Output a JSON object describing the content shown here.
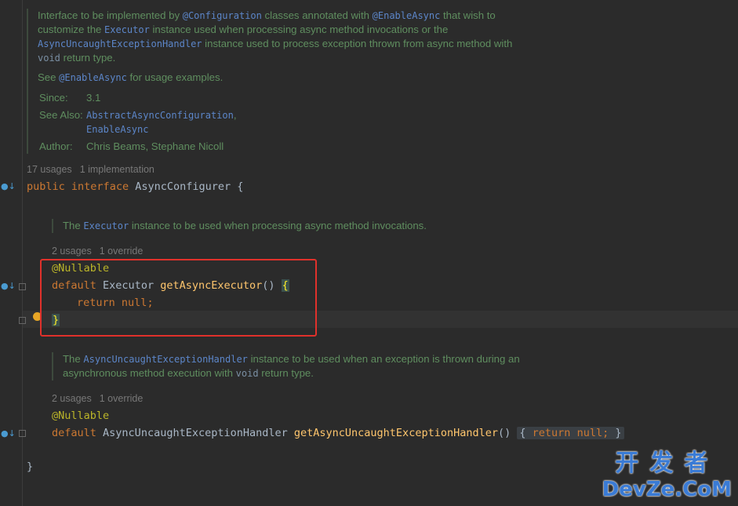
{
  "top_doc": {
    "line1_pre": "Interface to be implemented by ",
    "line1_link1": "@Configuration",
    "line1_mid": " classes annotated with ",
    "line1_link2": "@EnableAsync",
    "line1_post": " that wish to",
    "line2_pre": "customize the ",
    "line2_code": "Executor",
    "line2_post": " instance used when processing async method invocations or the",
    "line3_code": "AsyncUncaughtExceptionHandler",
    "line3_post": " instance used to process exception thrown from async method with",
    "line4_code": "void",
    "line4_post": " return type.",
    "see_pre": "See ",
    "see_link": "@EnableAsync",
    "see_post": " for usage examples.",
    "since_label": "Since:",
    "since_value": "3.1",
    "see_also_label": "See Also:",
    "see_also_1": "AbstractAsyncConfiguration",
    "see_also_comma": ",",
    "see_also_2": "EnableAsync",
    "author_label": "Author:",
    "author_value": "Chris Beams, Stephane Nicoll"
  },
  "interface_meta": {
    "usages": "17 usages",
    "impls": "1 implementation"
  },
  "interface_line": {
    "kw1": "public",
    "kw2": "interface",
    "name": "AsyncConfigurer",
    "brace": "{"
  },
  "doc2": {
    "pre": "The ",
    "code": "Executor",
    "post": " instance to be used when processing async method invocations."
  },
  "meta2": {
    "usages": "2 usages",
    "overrides": "1 override"
  },
  "method1": {
    "annotation": "@Nullable",
    "kw": "default",
    "type": "Executor",
    "name": "getAsyncExecutor",
    "parens": "()",
    "open": "{",
    "ret_kw": "return",
    "ret_val": "null",
    "semi": ";",
    "close": "}"
  },
  "doc3": {
    "pre": "The ",
    "code": "AsyncUncaughtExceptionHandler",
    "post": " instance to be used when an exception is thrown during an",
    "line2_pre": "asynchronous method execution with ",
    "line2_code": "void",
    "line2_post": " return type."
  },
  "meta3": {
    "usages": "2 usages",
    "overrides": "1 override"
  },
  "method2": {
    "annotation": "@Nullable",
    "kw": "default",
    "type": "AsyncUncaughtExceptionHandler",
    "name": "getAsyncUncaughtExceptionHandler",
    "parens": "()",
    "body_open": "{",
    "ret_kw": "return",
    "ret_val": "null;",
    "body_close": "}"
  },
  "closing_brace": "}",
  "watermark": {
    "cn": "开发者",
    "en": "DevZe.CoM"
  },
  "colors": {
    "accent_red": "#e0312b",
    "keyword": "#cc7832",
    "annotation": "#bbb529",
    "method": "#ffc66d"
  }
}
